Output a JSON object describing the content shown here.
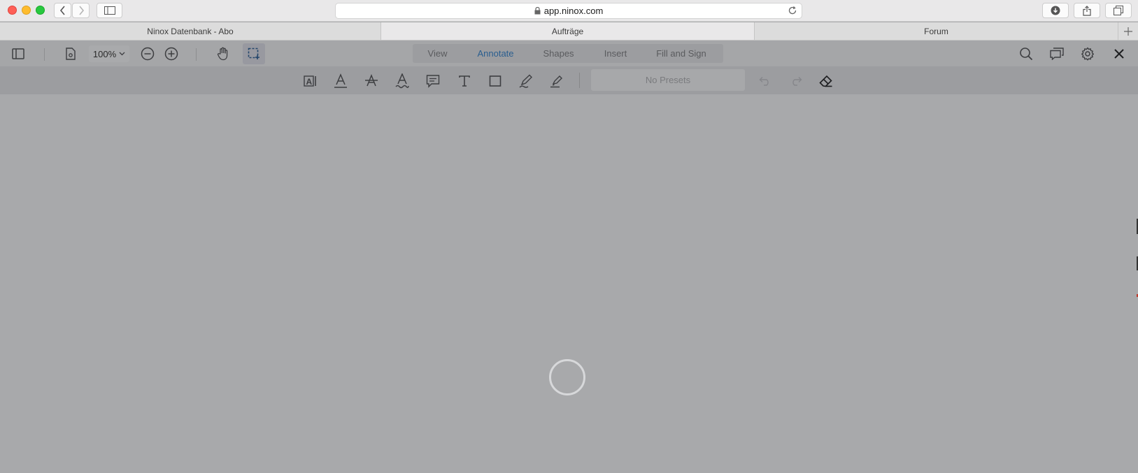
{
  "browser": {
    "url": "app.ninox.com",
    "tabs": [
      {
        "label": "Ninox Datenbank - Abo"
      },
      {
        "label": "Aufträge"
      },
      {
        "label": "Forum"
      }
    ]
  },
  "viewer": {
    "zoom": "100%",
    "ribbon_tabs": [
      {
        "label": "View"
      },
      {
        "label": "Annotate"
      },
      {
        "label": "Shapes"
      },
      {
        "label": "Insert"
      },
      {
        "label": "Fill and Sign"
      }
    ],
    "active_ribbon_tab": "Annotate",
    "presets_label": "No Presets"
  },
  "colors": {
    "accent": "#2a5e8f",
    "viewer_bg": "#a8a9ab",
    "toolbar_bg": "#9c9da0"
  }
}
